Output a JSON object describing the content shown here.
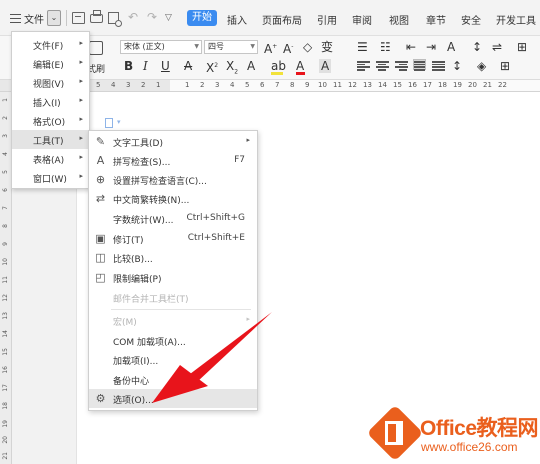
{
  "tabbar": {
    "file_label": "文件",
    "active_tab": "开始",
    "tabs": [
      "插入",
      "页面布局",
      "引用",
      "审阅",
      "视图",
      "章节",
      "安全",
      "开发工具"
    ]
  },
  "toolbar": {
    "paste_label": "式刷",
    "font_name": "宋体 (正文)",
    "font_size": "四号"
  },
  "ruler": {
    "numbers": [
      "5",
      "4",
      "3",
      "2",
      "1",
      "1",
      "2",
      "3",
      "4",
      "5",
      "6",
      "7",
      "8",
      "9",
      "10",
      "11",
      "12",
      "13",
      "14",
      "15",
      "16",
      "17",
      "18",
      "19",
      "20",
      "21",
      "22"
    ],
    "vertical_numbers": [
      "1",
      "2",
      "3",
      "4",
      "5",
      "6",
      "7",
      "8",
      "9",
      "10",
      "11",
      "12",
      "13",
      "14",
      "15",
      "16",
      "17",
      "18",
      "19",
      "20",
      "21"
    ]
  },
  "main_menu": {
    "items": [
      {
        "label": "文件(F)"
      },
      {
        "label": "编辑(E)"
      },
      {
        "label": "视图(V)"
      },
      {
        "label": "插入(I)"
      },
      {
        "label": "格式(O)"
      },
      {
        "label": "工具(T)"
      },
      {
        "label": "表格(A)"
      },
      {
        "label": "窗口(W)"
      }
    ],
    "active_index": 5
  },
  "tools_menu": {
    "items": [
      {
        "label": "文字工具(D)",
        "icon": "text-tool-icon"
      },
      {
        "label": "拼写检查(S)...",
        "shortcut": "F7",
        "icon": "spellcheck-icon"
      },
      {
        "label": "设置拼写检查语言(C)...",
        "icon": "language-globe-icon"
      },
      {
        "label": "中文简繁转换(N)...",
        "icon": "convert-icon"
      },
      {
        "label": "字数统计(W)...",
        "shortcut": "Ctrl+Shift+G"
      },
      {
        "label": "修订(T)",
        "shortcut": "Ctrl+Shift+E",
        "icon": "revision-icon"
      },
      {
        "label": "比较(B)...",
        "icon": "compare-icon"
      },
      {
        "label": "限制编辑(P)",
        "icon": "restrict-edit-icon"
      },
      {
        "label": "邮件合并工具栏(T)"
      },
      {
        "label": "宏(M)"
      },
      {
        "label": "COM 加载项(A)..."
      },
      {
        "label": "加载项(I)..."
      },
      {
        "label": "备份中心"
      },
      {
        "label": "选项(O)...",
        "icon": "gear-icon"
      }
    ],
    "highlight_index": 13
  },
  "watermark": {
    "title": "Office教程网",
    "url": "www.office26.com",
    "color": "#ea5f1d"
  },
  "colors": {
    "accent": "#3a8bf0",
    "arrow": "#e8141b"
  }
}
